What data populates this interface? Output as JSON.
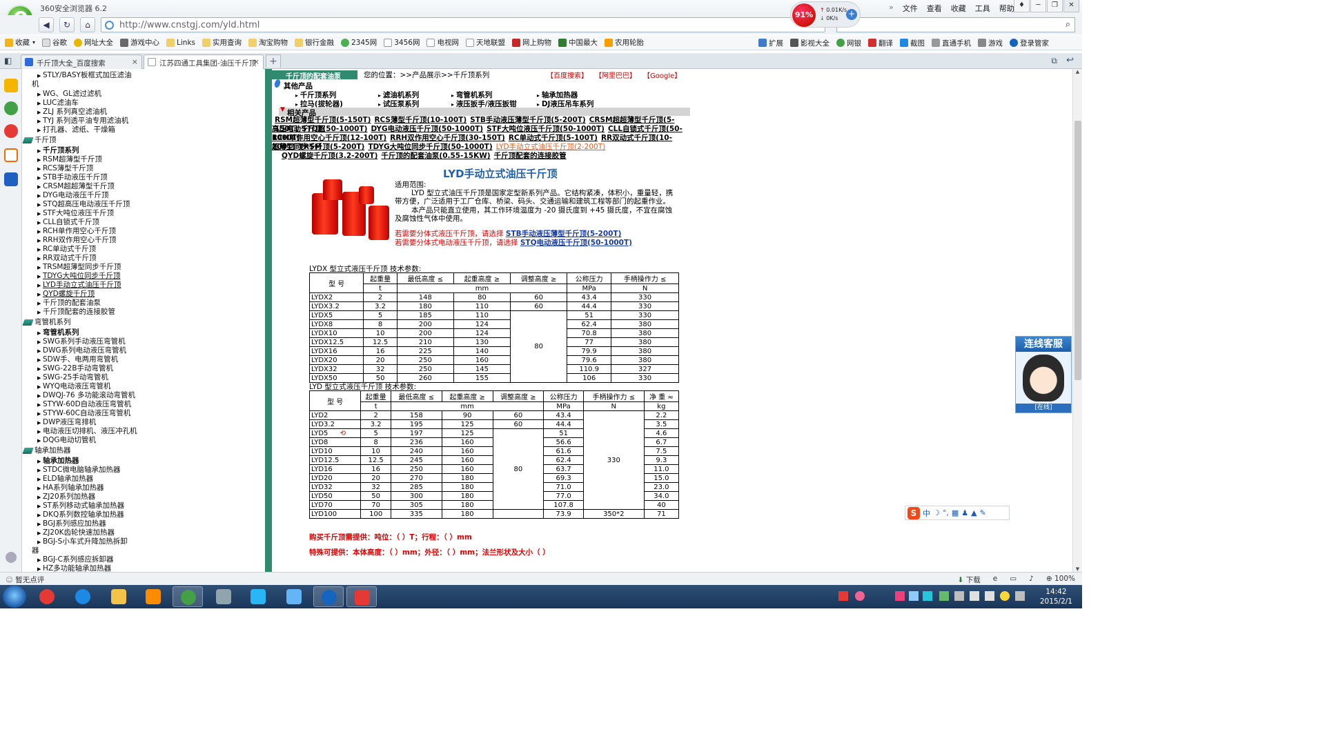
{
  "window": {
    "title": "360安全浏览器 6.2",
    "menu": [
      "文件",
      "查看",
      "收藏",
      "工具",
      "帮助"
    ]
  },
  "speed": {
    "percent": "91%",
    "up": "0.01K/s",
    "down": "0K/s"
  },
  "address": {
    "url": "http://www.cnstgj.com/yld.html"
  },
  "bookmarks": [
    "收藏",
    "谷歌",
    "网址大全",
    "游戏中心",
    "Links",
    "实用查询",
    "淘宝购物",
    "银行金融",
    "2345网",
    "3456网",
    "电视网",
    "天地联盟",
    "网上购物",
    "中国最大",
    "农用轮胎"
  ],
  "toolbar_right": [
    "扩展",
    "影视大全",
    "网银",
    "翻译",
    "截图",
    "直通手机",
    "游戏",
    "登录管家"
  ],
  "tabs": [
    {
      "label": "千斤顶大全_百度搜索"
    },
    {
      "label": "江苏四通工具集团-油压千斤顶"
    }
  ],
  "sidebar": {
    "rows": [
      {
        "text": "STLY/BASY板框式加压滤油",
        "kind": "item"
      },
      {
        "text": "机",
        "kind": "cont"
      },
      {
        "text": "WG、GL滤过滤机",
        "kind": "item"
      },
      {
        "text": "LUC滤油车",
        "kind": "item"
      },
      {
        "text": "ZLJ 系列真空滤油机",
        "kind": "item"
      },
      {
        "text": "TYJ 系列透平油专用滤油机",
        "kind": "item"
      },
      {
        "text": "打孔器、滤纸、干燥箱",
        "kind": "item"
      },
      {
        "text": "千斤顶",
        "kind": "cat"
      },
      {
        "text": "千斤顶系列",
        "kind": "bold"
      },
      {
        "text": "RSM超薄型千斤顶",
        "kind": "item"
      },
      {
        "text": "RCS薄型千斤顶",
        "kind": "item"
      },
      {
        "text": "STB手动液压千斤顶",
        "kind": "item"
      },
      {
        "text": "CRSM超超薄型千斤顶",
        "kind": "item"
      },
      {
        "text": "DYG电动液压千斤顶",
        "kind": "item"
      },
      {
        "text": "STQ超高压电动液压千斤顶",
        "kind": "item"
      },
      {
        "text": "STF大吨位液压千斤顶",
        "kind": "item"
      },
      {
        "text": "CLL自锁式千斤顶",
        "kind": "item"
      },
      {
        "text": "RCH单作用空心千斤顶",
        "kind": "item"
      },
      {
        "text": "RRH双作用空心千斤顶",
        "kind": "item"
      },
      {
        "text": "RC单动式千斤顶",
        "kind": "item"
      },
      {
        "text": "RR双动式千斤顶",
        "kind": "item"
      },
      {
        "text": "TRSM超薄型同步千斤顶",
        "kind": "item"
      },
      {
        "text": "TDYG大吨位同步千斤顶",
        "kind": "und"
      },
      {
        "text": "LYD手动立式油压千斤顶",
        "kind": "und"
      },
      {
        "text": "QYD螺旋千斤顶",
        "kind": "und"
      },
      {
        "text": "千斤顶的配套油泵",
        "kind": "item"
      },
      {
        "text": "千斤顶配套的连接胶管",
        "kind": "item"
      },
      {
        "text": "弯管机系列",
        "kind": "cat"
      },
      {
        "text": "弯管机系列",
        "kind": "bold"
      },
      {
        "text": "SWG系列手动液压弯管机",
        "kind": "item"
      },
      {
        "text": "DWG系列电动液压弯管机",
        "kind": "item"
      },
      {
        "text": "SDW手、电两用弯管机",
        "kind": "item"
      },
      {
        "text": "SWG-22B手动弯管机",
        "kind": "item"
      },
      {
        "text": "SWG-25手动弯管机",
        "kind": "item"
      },
      {
        "text": "WYQ电动液压弯管机",
        "kind": "item"
      },
      {
        "text": "DWQJ-76 多功能滚动弯管机",
        "kind": "item"
      },
      {
        "text": "STYW-60D自动液压弯管机",
        "kind": "item"
      },
      {
        "text": "STYW-60C自动液压弯管机",
        "kind": "item"
      },
      {
        "text": "DWP液压弯排机",
        "kind": "item"
      },
      {
        "text": "电动液压切排机、液压冲孔机",
        "kind": "item"
      },
      {
        "text": "DQG电动切管机",
        "kind": "item"
      },
      {
        "text": "轴承加热器",
        "kind": "cat"
      },
      {
        "text": "轴承加热器",
        "kind": "bold"
      },
      {
        "text": "STDC微电脑轴承加热器",
        "kind": "item"
      },
      {
        "text": "ELD轴承加热器",
        "kind": "item"
      },
      {
        "text": "HA系列轴承加热器",
        "kind": "item"
      },
      {
        "text": "ZJ20系列加热器",
        "kind": "item"
      },
      {
        "text": "ST系列移动式轴承加热器",
        "kind": "item"
      },
      {
        "text": "DKQ系列数控轴承加热器",
        "kind": "item"
      },
      {
        "text": "BGJ系列感应加热器",
        "kind": "item"
      },
      {
        "text": "ZJ20K齿轮快速加热器",
        "kind": "item"
      },
      {
        "text": "BGJ-S小车式升降加热拆卸",
        "kind": "item"
      },
      {
        "text": "器",
        "kind": "cont"
      },
      {
        "text": "BGJ-C系列感应拆卸器",
        "kind": "item"
      },
      {
        "text": "HZ多功能轴承加热器",
        "kind": "item"
      }
    ]
  },
  "content": {
    "green_label": "千斤顶的配套油泵",
    "location": "您的位置：>>产品展示>>千斤顶系列",
    "searches": [
      "【百度搜索】",
      "【阿里巴巴】",
      "【Google】"
    ],
    "other_heading": "其他产品",
    "other_products": [
      [
        "千斤顶系列",
        "滤油机系列",
        "弯管机系列",
        "轴承加热器"
      ],
      [
        "拉马(拔轮器)",
        "试压泵系列",
        "液压扳手/液压扳钳",
        "DJ液压吊车系列"
      ]
    ],
    "related_heading": "相关产品",
    "related_lines": [
      [
        "RSM超薄型千斤顶(5-150T)",
        "RCS薄型千斤顶(10-100T)",
        "STB手动液压薄型千斤顶(5-200T)",
        "CRSM超超薄型千斤顶(5-150T)",
        "STQ超"
      ],
      [
        "高压电动千斤顶(50-1000T)",
        "DYG电动液压千斤顶(50-1000T)",
        "STF大吨位液压千斤顶(50-1000T)",
        "CLL自锁式千斤顶(50-1000T)"
      ],
      [
        "RCH单作用空心千斤顶(12-100T)",
        "RRH双作用空心千斤顶(30-150T)",
        "RC单动式千斤顶(5-100T)",
        "RR双动式千斤顶(10-200T)",
        "TRSM"
      ],
      [
        "超薄型同步千斤顶(5-200T)",
        "TDYG大吨位同步千斤顶(50-1000T)",
        "LYD手动立式油压千斤顶(2-200T)"
      ],
      [
        "QYD螺旋千斤顶(3.2-200T)",
        "千斤顶的配套油泵(0.55-15KW)",
        "千斤顶配套的连接胶管"
      ]
    ],
    "product_title": "LYD手动立式油压千斤顶",
    "usage_heading": "适用范围:",
    "usage_p1": "LYD 型立式油压千斤顶是国家定型新系列产品。它结构紧凑，体积小，重量轻，携带方便，广泛适用于工厂仓库、桥梁、码头、交通运输和建筑工程等部门的起重作业。",
    "usage_p2": "本产品只能直立使用，其工作环境温度为 -20 摄氏度到 +45 摄氏度，不宜在腐蚀及腐蚀性气体中使用。",
    "hint1_pre": "若需要分体式液压千斤顶，请选择",
    "hint1_link": "STB手动液压薄型千斤顶(5-200T)",
    "hint2_pre": "若需要分体式电动液压千斤顶，请选择",
    "hint2_link": "STQ电动液压千斤顶(50-1000T)",
    "footer1": "购买千斤顶需提供：吨位：（ ）T；行程：（ ）mm",
    "footer2": "特殊可提供：本体高度：（ ）mm；外径：（ ）mm；法兰形状及大小（ ）"
  },
  "table1": {
    "caption": "LYDX 型立式液压千斤顶 技术参数:",
    "headers": [
      "型 号",
      "起重量",
      "最低高度 ≤",
      "起重高度 ≥",
      "调整高度 ≥",
      "公称压力",
      "手柄操作力 ≤"
    ],
    "units": [
      "t",
      "mm",
      "MPa",
      "N"
    ],
    "adjust_merged": "80",
    "rows": [
      [
        "LYDX2",
        "2",
        "148",
        "80",
        "60",
        "43.4",
        "330"
      ],
      [
        "LYDX3.2",
        "3.2",
        "180",
        "110",
        "60",
        "44.4",
        "330"
      ],
      [
        "LYDX5",
        "5",
        "185",
        "110",
        "",
        "51",
        "330"
      ],
      [
        "LYDX8",
        "8",
        "200",
        "124",
        "",
        "62.4",
        "380"
      ],
      [
        "LYDX10",
        "10",
        "200",
        "124",
        "",
        "70.8",
        "380"
      ],
      [
        "LYDX12.5",
        "12.5",
        "210",
        "130",
        "",
        "77",
        "380"
      ],
      [
        "LYDX16",
        "16",
        "225",
        "140",
        "",
        "79.9",
        "380"
      ],
      [
        "LYDX20",
        "20",
        "250",
        "160",
        "",
        "79.6",
        "380"
      ],
      [
        "LYDX32",
        "32",
        "250",
        "145",
        "",
        "110.9",
        "327"
      ],
      [
        "LYDX50",
        "50",
        "260",
        "155",
        "",
        "106",
        "330"
      ]
    ]
  },
  "table2": {
    "caption": "LYD 型立式液压千斤顶 技术参数:",
    "headers": [
      "型 号",
      "起重量",
      "最低高度 ≤",
      "起重高度 ≥",
      "调整高度 ≥",
      "公称压力",
      "手柄操作力 ≤",
      "净 重 ≈"
    ],
    "units": [
      "t",
      "mm",
      "MPa",
      "N",
      "kg"
    ],
    "adjust_merged": "80",
    "force_merged": "330",
    "rows": [
      [
        "LYD2",
        "2",
        "158",
        "90",
        "60",
        "43.4",
        "",
        "2.2"
      ],
      [
        "LYD3.2",
        "3.2",
        "195",
        "125",
        "60",
        "44.4",
        "",
        "3.5"
      ],
      [
        "LYD5",
        "5",
        "197",
        "125",
        "",
        "51",
        "",
        "4.6"
      ],
      [
        "LYD8",
        "8",
        "236",
        "160",
        "",
        "56.6",
        "",
        "6.7"
      ],
      [
        "LYD10",
        "10",
        "240",
        "160",
        "",
        "61.6",
        "",
        "7.5"
      ],
      [
        "LYD12.5",
        "12.5",
        "245",
        "160",
        "",
        "62.4",
        "",
        "9.3"
      ],
      [
        "LYD16",
        "16",
        "250",
        "160",
        "",
        "63.7",
        "",
        "11.0"
      ],
      [
        "LYD20",
        "20",
        "270",
        "180",
        "",
        "69.3",
        "",
        "15.0"
      ],
      [
        "LYD32",
        "32",
        "285",
        "180",
        "",
        "71.0",
        "",
        "23.0"
      ],
      [
        "LYD50",
        "50",
        "300",
        "180",
        "",
        "77.0",
        "",
        "34.0"
      ],
      [
        "LYD70",
        "70",
        "305",
        "180",
        "",
        "107.8",
        "",
        "40"
      ],
      [
        "LYD100",
        "100",
        "335",
        "180",
        "",
        "73.9",
        "350*2",
        "71"
      ]
    ]
  },
  "service": {
    "title": "连线客服",
    "status": "[在线]"
  },
  "ime": {
    "lang": "中"
  },
  "statusbar": {
    "left": "暂无点评",
    "download": "下载",
    "zoom": "100%"
  },
  "taskbar": {
    "time": "14:42",
    "date": "2015/2/1"
  }
}
